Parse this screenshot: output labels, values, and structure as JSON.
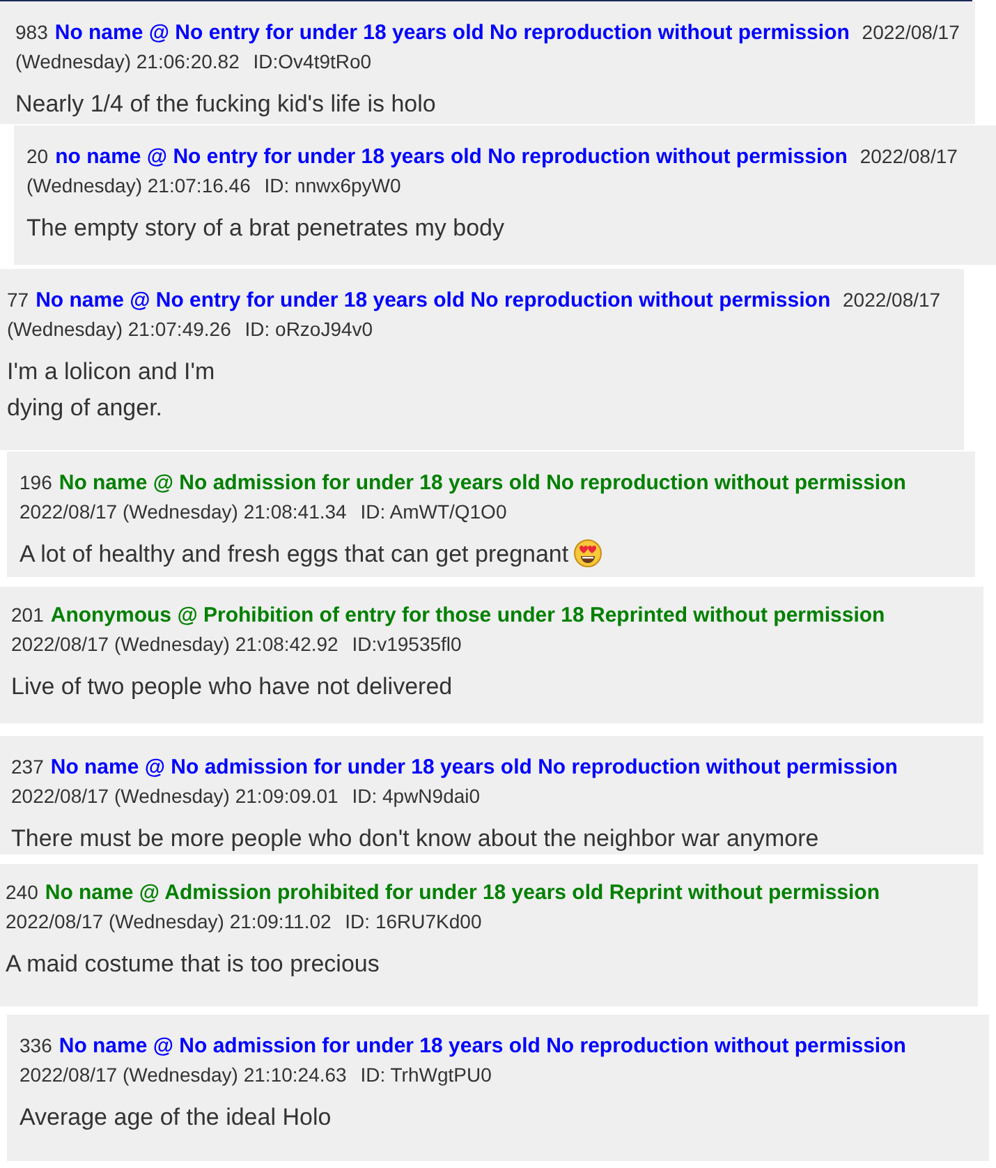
{
  "posts": [
    {
      "number": "983",
      "name": "No name @ No entry for under 18 years old No reproduction without permission",
      "color": "#0000ff",
      "date": "2022/08/17",
      "time": "(Wednesday) 21:06:20.82",
      "id": "ID:Ov4t9tRo0",
      "body": [
        "Nearly 1/4 of the fucking kid's life is holo"
      ]
    },
    {
      "number": "20",
      "name": "no name @ No entry for under 18 years old No reproduction without permission",
      "color": "#0000ff",
      "date": "2022/08/17",
      "time": "(Wednesday) 21:07:16.46",
      "id": "ID: nnwx6pyW0",
      "body": [
        "The empty story of a brat penetrates my body"
      ]
    },
    {
      "number": "77",
      "name": "No name @ No entry for under 18 years old No reproduction without permission",
      "color": "#0000ff",
      "date": "2022/08/17",
      "time": "(Wednesday) 21:07:49.26",
      "id": "ID: oRzoJ94v0",
      "body": [
        "I'm a lolicon and I'm",
        "dying of anger."
      ]
    },
    {
      "number": "196",
      "name": "No name @ No admission for under 18 years old No reproduction without permission",
      "color": "#008000",
      "date": "2022/08/17",
      "time": "(Wednesday) 21:08:41.34",
      "id": "ID: AmWT/Q1O0",
      "body": [
        "A lot of healthy and fresh eggs that can get pregnant"
      ],
      "has_emoji": true
    },
    {
      "number": "201",
      "name": "Anonymous @ Prohibition of entry for those under 18 Reprinted without permission",
      "color": "#008000",
      "date": "2022/08/17",
      "time": "(Wednesday) 21:08:42.92",
      "id": "ID:v19535fl0",
      "body": [
        "Live of two people who have not delivered"
      ]
    },
    {
      "number": "237",
      "name": "No name @ No admission for under 18 years old No reproduction without permission",
      "color": "#0000ff",
      "date": "2022/08/17",
      "time": "(Wednesday) 21:09:09.01",
      "id": "ID: 4pwN9dai0",
      "body": [
        "There must be more people who don't know about the neighbor war anymore"
      ]
    },
    {
      "number": "240",
      "name": "No name @ Admission prohibited for under 18 years old Reprint without permission",
      "color": "#008000",
      "date": "2022/08/17",
      "time": "(Wednesday) 21:09:11.02",
      "id": "ID: 16RU7Kd00",
      "body": [
        "A maid costume that is too precious"
      ]
    },
    {
      "number": "336",
      "name": "No name @ No admission for under 18 years old No reproduction without permission",
      "color": "#0000ff",
      "date": "2022/08/17",
      "time": "(Wednesday) 21:10:24.63",
      "id": "ID: TrhWgtPU0",
      "body": [
        "Average age of the ideal Holo"
      ]
    }
  ]
}
